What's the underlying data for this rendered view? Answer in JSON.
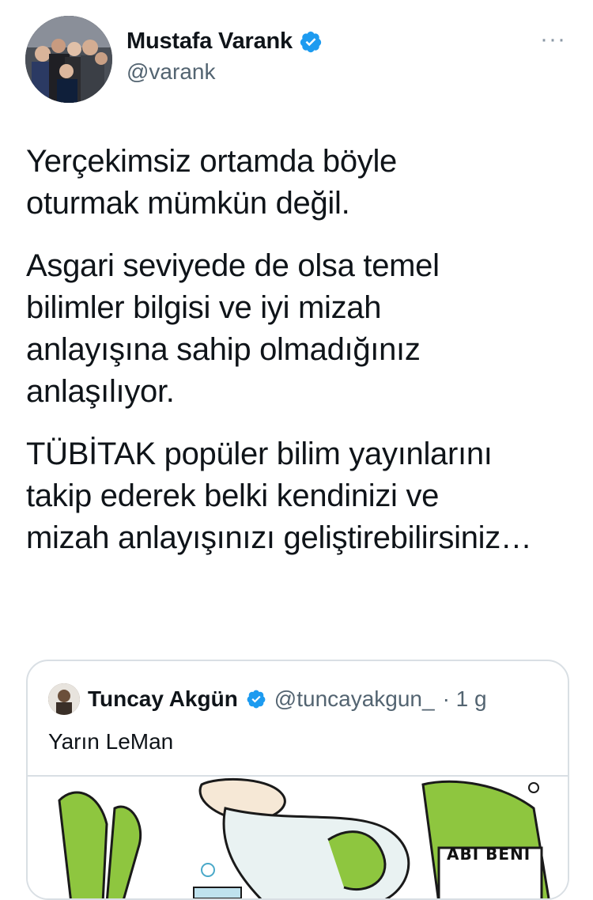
{
  "author": {
    "name": "Mustafa Varank",
    "handle": "@varank",
    "verified_icon": "verified-badge-icon",
    "accent_color": "#1d9bf0"
  },
  "menu": {
    "icon": "more-options-icon",
    "glyph": "···"
  },
  "tweet": {
    "paragraphs": [
      "Yerçekimsiz ortamda böyle\noturmak mümkün değil.",
      "Asgari seviyede de olsa temel\nbilimler bilgisi ve iyi mizah\nanlayışına sahip olmadığınız\nanlaşılıyor.",
      "TÜBİTAK popüler bilim yayınlarını\ntakip ederek belki kendinizi ve\nmizah anlayışınızı geliştirebilirsiniz…"
    ]
  },
  "quoted": {
    "name": "Tuncay Akgün",
    "handle": "@tuncayakgun_",
    "time": "· 1 g",
    "text": "Yarın LeMan",
    "image_caption": "ABI BENI"
  }
}
